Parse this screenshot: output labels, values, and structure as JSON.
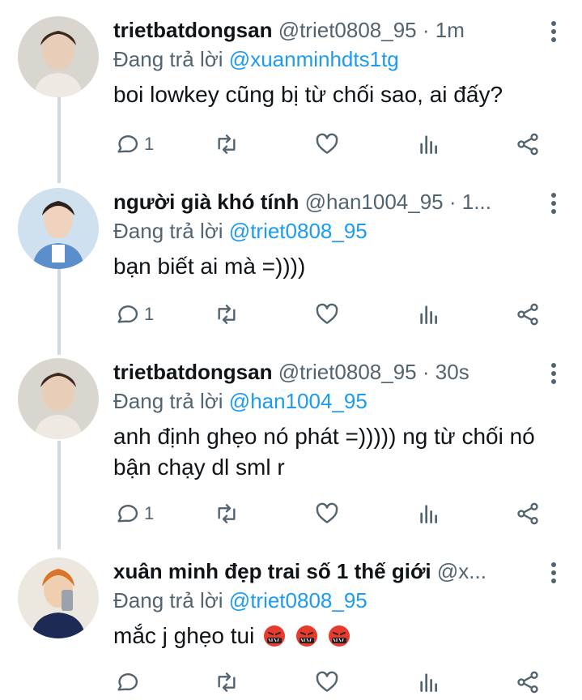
{
  "tweets": [
    {
      "name": "trietbatdongsan",
      "handle": "@triet0808_95",
      "sep": "·",
      "time": "1m",
      "replying_prefix": "Đang trả lời",
      "replying_to": "@xuanminhdts1tg",
      "text": "boi lowkey cũng bị từ chối sao, ai đấy?",
      "reply_count": "1"
    },
    {
      "name": "người già khó tính",
      "handle": "@han1004_95",
      "sep": "·",
      "time": "1...",
      "replying_prefix": "Đang trả lời",
      "replying_to": "@triet0808_95",
      "text": "bạn biết ai mà =))))",
      "reply_count": "1"
    },
    {
      "name": "trietbatdongsan",
      "handle": "@triet0808_95",
      "sep": "·",
      "time": "30s",
      "replying_prefix": "Đang trả lời",
      "replying_to": "@han1004_95",
      "text": "anh định ghẹo nó phát =))))) ng từ chối nó bận chạy dl sml r",
      "reply_count": "1"
    },
    {
      "name": "xuân minh đẹp trai số 1 thế giới",
      "handle": "@x...",
      "sep": "",
      "time": "",
      "replying_prefix": "Đang trả lời",
      "replying_to": "@triet0808_95",
      "text": "mắc j ghẹo tui",
      "reply_count": "",
      "emoji": [
        "cursing-face",
        "cursing-face",
        "cursing-face"
      ]
    }
  ],
  "colors": {
    "accent": "#1d9bf0",
    "muted": "#536471",
    "text": "#0f1419",
    "line": "#cfd9de"
  }
}
